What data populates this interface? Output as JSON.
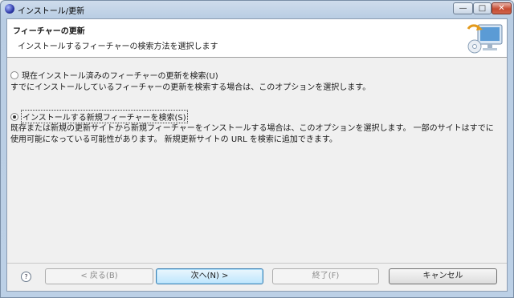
{
  "window": {
    "title": "インストール/更新",
    "min_glyph": "—",
    "max_glyph": "□",
    "close_glyph": "✕"
  },
  "header": {
    "title": "フィーチャーの更新",
    "description": "インストールするフィーチャーの検索方法を選択します"
  },
  "options": [
    {
      "label": "現在インストール済みのフィーチャーの更新を検索(U)",
      "description": "すでにインストールしているフィーチャーの更新を検索する場合は、このオプションを選択します。",
      "selected": false
    },
    {
      "label": "インストールする新規フィーチャーを検索(S)",
      "description": "既存または新規の更新サイトから新規フィーチャーをインストールする場合は、このオプションを選択します。 一部のサイトはすでに使用可能になっている可能性があります。 新規更新サイトの URL を検索に追加できます。",
      "selected": true
    }
  ],
  "footer": {
    "help_glyph": "?",
    "back_label": "< 戻る(B)",
    "next_label": "次へ(N) >",
    "finish_label": "終了(F)",
    "cancel_label": "キャンセル"
  }
}
